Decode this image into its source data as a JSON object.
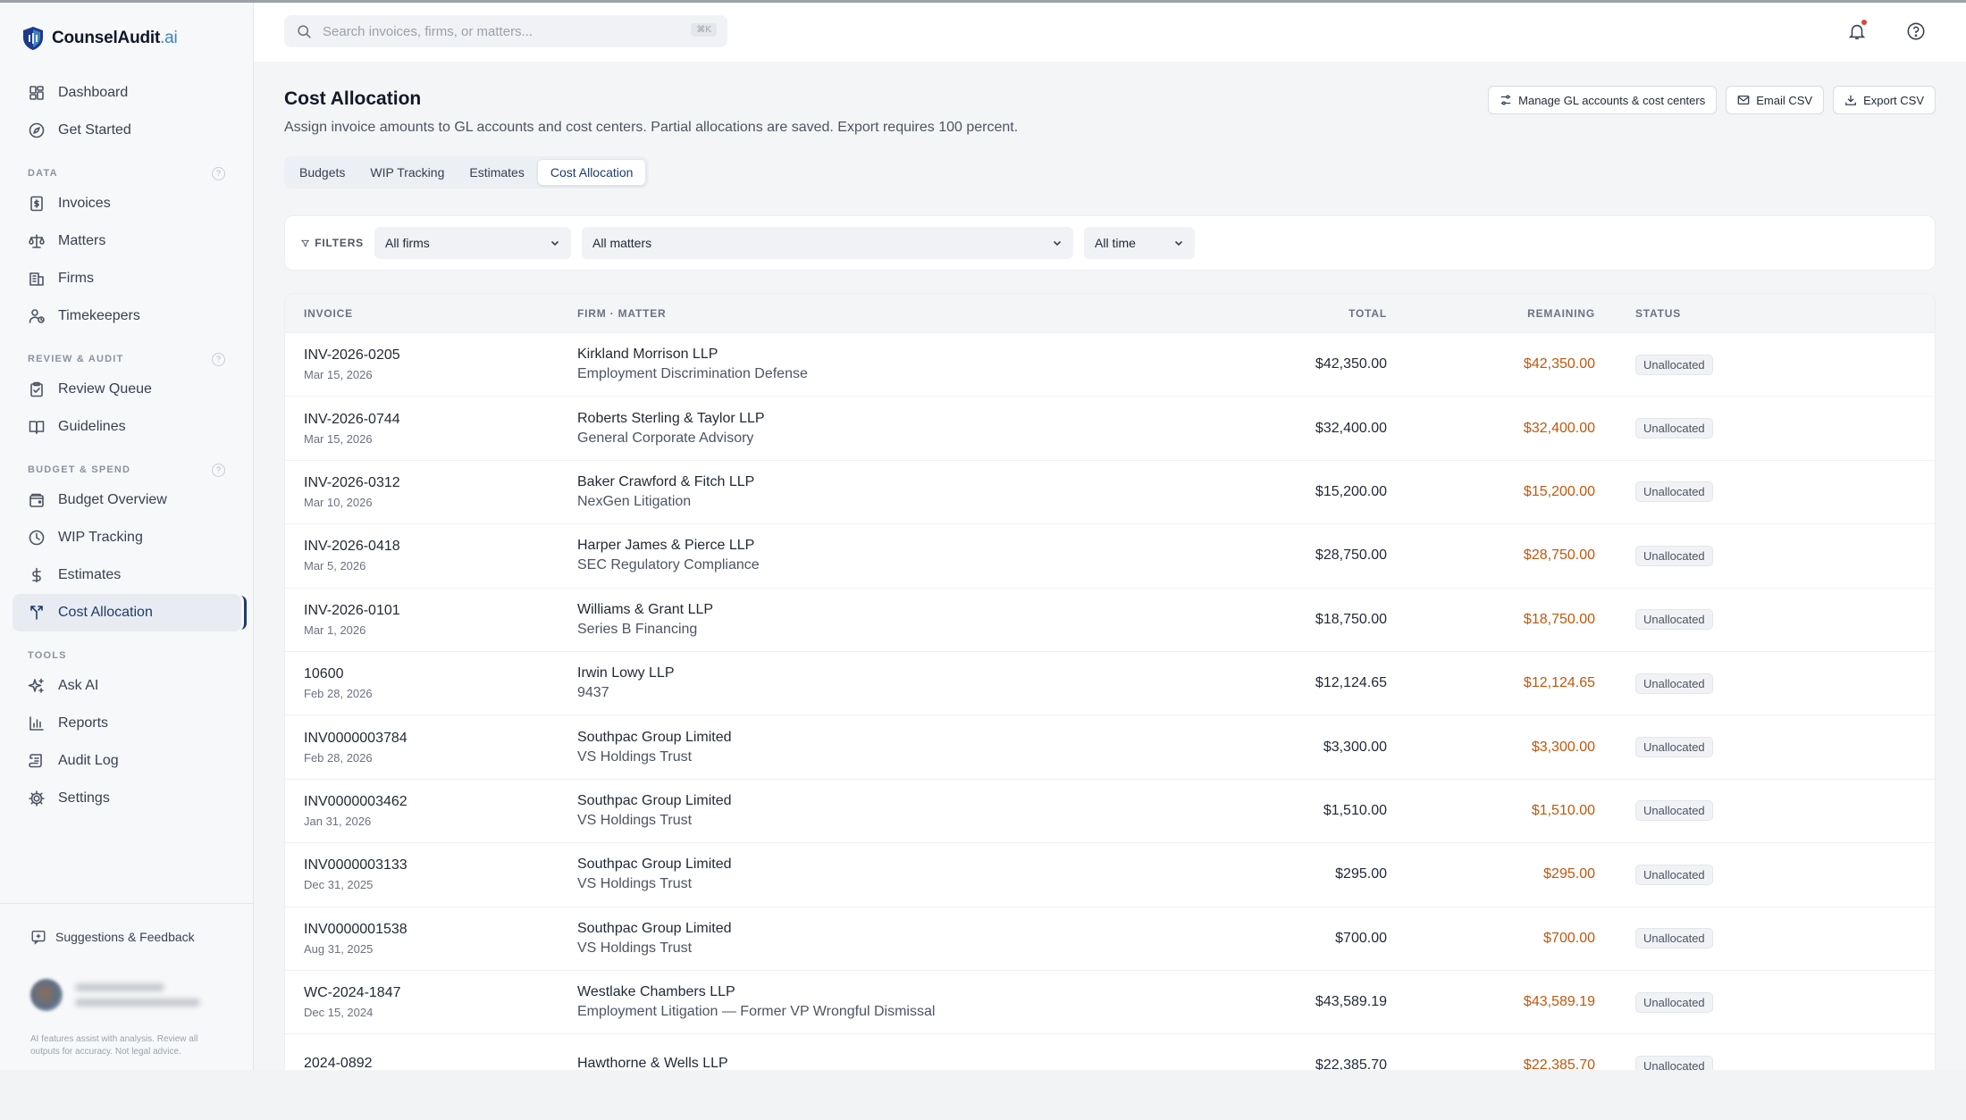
{
  "app": {
    "name": "CounselAudit",
    "suffix": ".ai"
  },
  "sidebar": {
    "top_items": [
      {
        "label": "Dashboard",
        "icon": "dashboard-icon"
      },
      {
        "label": "Get Started",
        "icon": "compass-icon"
      }
    ],
    "sections": [
      {
        "title": "DATA",
        "items": [
          {
            "label": "Invoices",
            "icon": "invoice-icon"
          },
          {
            "label": "Matters",
            "icon": "scale-icon"
          },
          {
            "label": "Firms",
            "icon": "building-icon"
          },
          {
            "label": "Timekeepers",
            "icon": "user-clock-icon"
          }
        ]
      },
      {
        "title": "REVIEW & AUDIT",
        "items": [
          {
            "label": "Review Queue",
            "icon": "clipboard-check-icon"
          },
          {
            "label": "Guidelines",
            "icon": "book-icon"
          }
        ]
      },
      {
        "title": "BUDGET & SPEND",
        "items": [
          {
            "label": "Budget Overview",
            "icon": "wallet-icon"
          },
          {
            "label": "WIP Tracking",
            "icon": "clock-icon"
          },
          {
            "label": "Estimates",
            "icon": "dollar-icon"
          },
          {
            "label": "Cost Allocation",
            "icon": "split-icon",
            "active": true
          }
        ]
      },
      {
        "title": "TOOLS",
        "items": [
          {
            "label": "Ask AI",
            "icon": "sparkle-icon"
          },
          {
            "label": "Reports",
            "icon": "bar-chart-icon"
          },
          {
            "label": "Audit Log",
            "icon": "scroll-icon"
          },
          {
            "label": "Settings",
            "icon": "gear-icon"
          }
        ]
      }
    ],
    "feedback_label": "Suggestions & Feedback",
    "disclaimer": "AI features assist with analysis. Review all outputs for accuracy. Not legal advice."
  },
  "header": {
    "search_placeholder": "Search invoices, firms, or matters...",
    "search_shortcut": "⌘K"
  },
  "page": {
    "title": "Cost Allocation",
    "description": "Assign invoice amounts to GL accounts and cost centers. Partial allocations are saved. Export requires 100 percent.",
    "actions": [
      {
        "label": "Manage GL accounts & cost centers",
        "icon": "sliders-icon"
      },
      {
        "label": "Email CSV",
        "icon": "mail-icon"
      },
      {
        "label": "Export CSV",
        "icon": "download-icon"
      }
    ],
    "tabs": [
      {
        "label": "Budgets"
      },
      {
        "label": "WIP Tracking"
      },
      {
        "label": "Estimates"
      },
      {
        "label": "Cost Allocation",
        "active": true
      }
    ]
  },
  "filters": {
    "label": "FILTERS",
    "firm": "All firms",
    "matter": "All matters",
    "time": "All time"
  },
  "table": {
    "columns": {
      "invoice": "INVOICE",
      "firm_matter": "FIRM · MATTER",
      "total": "TOTAL",
      "remaining": "REMAINING",
      "status": "STATUS"
    },
    "rows": [
      {
        "invoice": "INV-2026-0205",
        "date": "Mar 15, 2026",
        "firm": "Kirkland Morrison LLP",
        "matter": "Employment Discrimination Defense",
        "total": "$42,350.00",
        "remaining": "$42,350.00",
        "status": "Unallocated"
      },
      {
        "invoice": "INV-2026-0744",
        "date": "Mar 15, 2026",
        "firm": "Roberts Sterling & Taylor LLP",
        "matter": "General Corporate Advisory",
        "total": "$32,400.00",
        "remaining": "$32,400.00",
        "status": "Unallocated"
      },
      {
        "invoice": "INV-2026-0312",
        "date": "Mar 10, 2026",
        "firm": "Baker Crawford & Fitch LLP",
        "matter": "NexGen Litigation",
        "total": "$15,200.00",
        "remaining": "$15,200.00",
        "status": "Unallocated"
      },
      {
        "invoice": "INV-2026-0418",
        "date": "Mar 5, 2026",
        "firm": "Harper James & Pierce LLP",
        "matter": "SEC Regulatory Compliance",
        "total": "$28,750.00",
        "remaining": "$28,750.00",
        "status": "Unallocated"
      },
      {
        "invoice": "INV-2026-0101",
        "date": "Mar 1, 2026",
        "firm": "Williams & Grant LLP",
        "matter": "Series B Financing",
        "total": "$18,750.00",
        "remaining": "$18,750.00",
        "status": "Unallocated"
      },
      {
        "invoice": "10600",
        "date": "Feb 28, 2026",
        "firm": "Irwin Lowy LLP",
        "matter": "9437",
        "total": "$12,124.65",
        "remaining": "$12,124.65",
        "status": "Unallocated"
      },
      {
        "invoice": "INV0000003784",
        "date": "Feb 28, 2026",
        "firm": "Southpac Group Limited",
        "matter": "VS Holdings Trust",
        "total": "$3,300.00",
        "remaining": "$3,300.00",
        "status": "Unallocated"
      },
      {
        "invoice": "INV0000003462",
        "date": "Jan 31, 2026",
        "firm": "Southpac Group Limited",
        "matter": "VS Holdings Trust",
        "total": "$1,510.00",
        "remaining": "$1,510.00",
        "status": "Unallocated"
      },
      {
        "invoice": "INV0000003133",
        "date": "Dec 31, 2025",
        "firm": "Southpac Group Limited",
        "matter": "VS Holdings Trust",
        "total": "$295.00",
        "remaining": "$295.00",
        "status": "Unallocated"
      },
      {
        "invoice": "INV0000001538",
        "date": "Aug 31, 2025",
        "firm": "Southpac Group Limited",
        "matter": "VS Holdings Trust",
        "total": "$700.00",
        "remaining": "$700.00",
        "status": "Unallocated"
      },
      {
        "invoice": "WC-2024-1847",
        "date": "Dec 15, 2024",
        "firm": "Westlake Chambers LLP",
        "matter": "Employment Litigation — Former VP Wrongful Dismissal",
        "total": "$43,589.19",
        "remaining": "$43,589.19",
        "status": "Unallocated"
      },
      {
        "invoice": "2024-0892",
        "date": "",
        "firm": "Hawthorne & Wells LLP",
        "matter": "",
        "total": "$22,385.70",
        "remaining": "$22,385.70",
        "status": "Unallocated"
      }
    ]
  },
  "colors": {
    "accent": "#1e3a6e",
    "remaining": "#c2570c",
    "notification": "#d64545"
  }
}
